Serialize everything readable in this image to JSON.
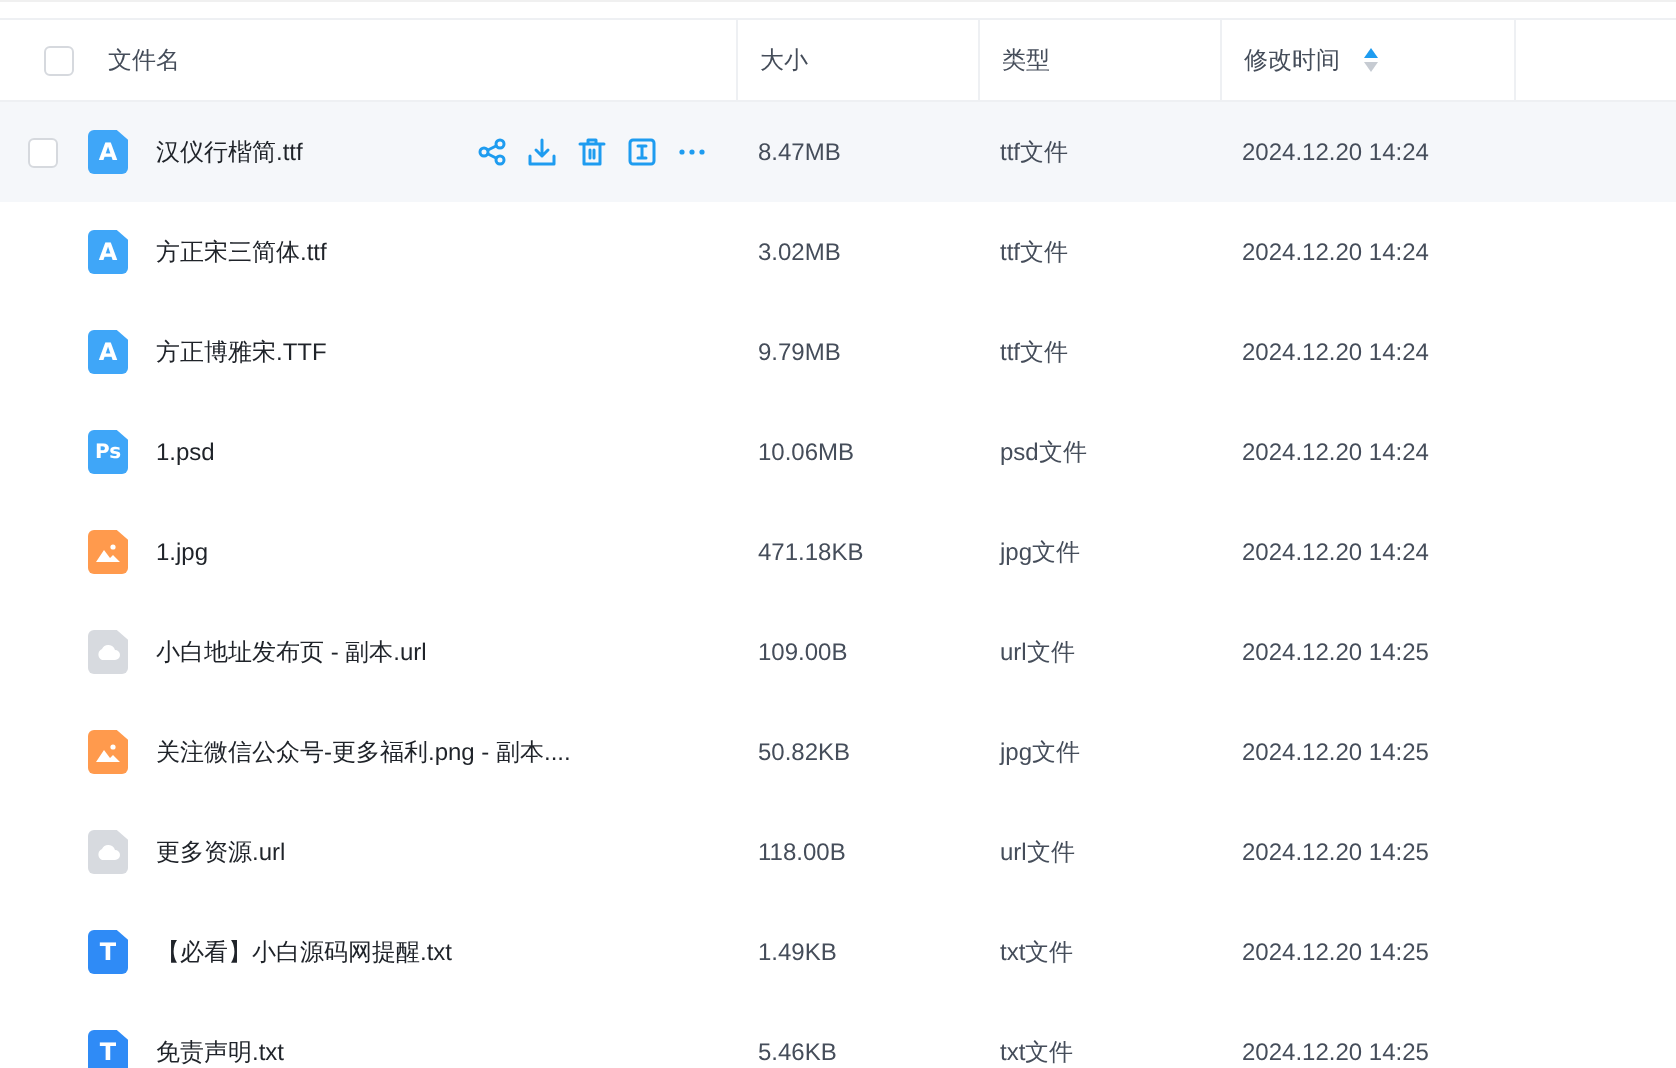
{
  "table": {
    "columns": [
      {
        "label": "文件名",
        "kind": "name"
      },
      {
        "label": "大小",
        "kind": "plain"
      },
      {
        "label": "类型",
        "kind": "plain"
      },
      {
        "label": "修改时间",
        "kind": "plain",
        "sorted_ascending": true
      }
    ],
    "all_checked": false,
    "rows": [
      {
        "name": "汉仪行楷简.ttf",
        "kind": "font",
        "icon_text": "A",
        "size": "8.47MB",
        "type": "ttf文件",
        "modified": "2024.12.20 14:24",
        "hovered": true,
        "checked": false
      },
      {
        "name": "方正宋三简体.ttf",
        "kind": "font",
        "icon_text": "A",
        "size": "3.02MB",
        "type": "ttf文件",
        "modified": "2024.12.20 14:24",
        "hovered": false,
        "checked": false
      },
      {
        "name": "方正博雅宋.TTF",
        "kind": "font",
        "icon_text": "A",
        "size": "9.79MB",
        "type": "ttf文件",
        "modified": "2024.12.20 14:24",
        "hovered": false,
        "checked": false
      },
      {
        "name": "1.psd",
        "kind": "font",
        "icon_text": "Ps",
        "size": "10.06MB",
        "type": "psd文件",
        "modified": "2024.12.20 14:24",
        "hovered": false,
        "checked": false
      },
      {
        "name": "1.jpg",
        "kind": "image",
        "size": "471.18KB",
        "type": "jpg文件",
        "modified": "2024.12.20 14:24",
        "hovered": false,
        "checked": false
      },
      {
        "name": "小白地址发布页 - 副本.url",
        "kind": "link",
        "size": "109.00B",
        "type": "url文件",
        "modified": "2024.12.20 14:25",
        "hovered": false,
        "checked": false
      },
      {
        "name": "关注微信公众号-更多福利.png - 副本....",
        "kind": "image",
        "size": "50.82KB",
        "type": "jpg文件",
        "modified": "2024.12.20 14:25",
        "hovered": false,
        "checked": false
      },
      {
        "name": "更多资源.url",
        "kind": "link",
        "size": "118.00B",
        "type": "url文件",
        "modified": "2024.12.20 14:25",
        "hovered": false,
        "checked": false
      },
      {
        "name": "【必看】小白源码网提醒.txt",
        "kind": "text",
        "icon_text": "T",
        "size": "1.49KB",
        "type": "txt文件",
        "modified": "2024.12.20 14:25",
        "hovered": false,
        "checked": false
      },
      {
        "name": "免责声明.txt",
        "kind": "text",
        "icon_text": "T",
        "size": "5.46KB",
        "type": "txt文件",
        "modified": "2024.12.20 14:25",
        "hovered": false,
        "checked": false
      }
    ]
  }
}
